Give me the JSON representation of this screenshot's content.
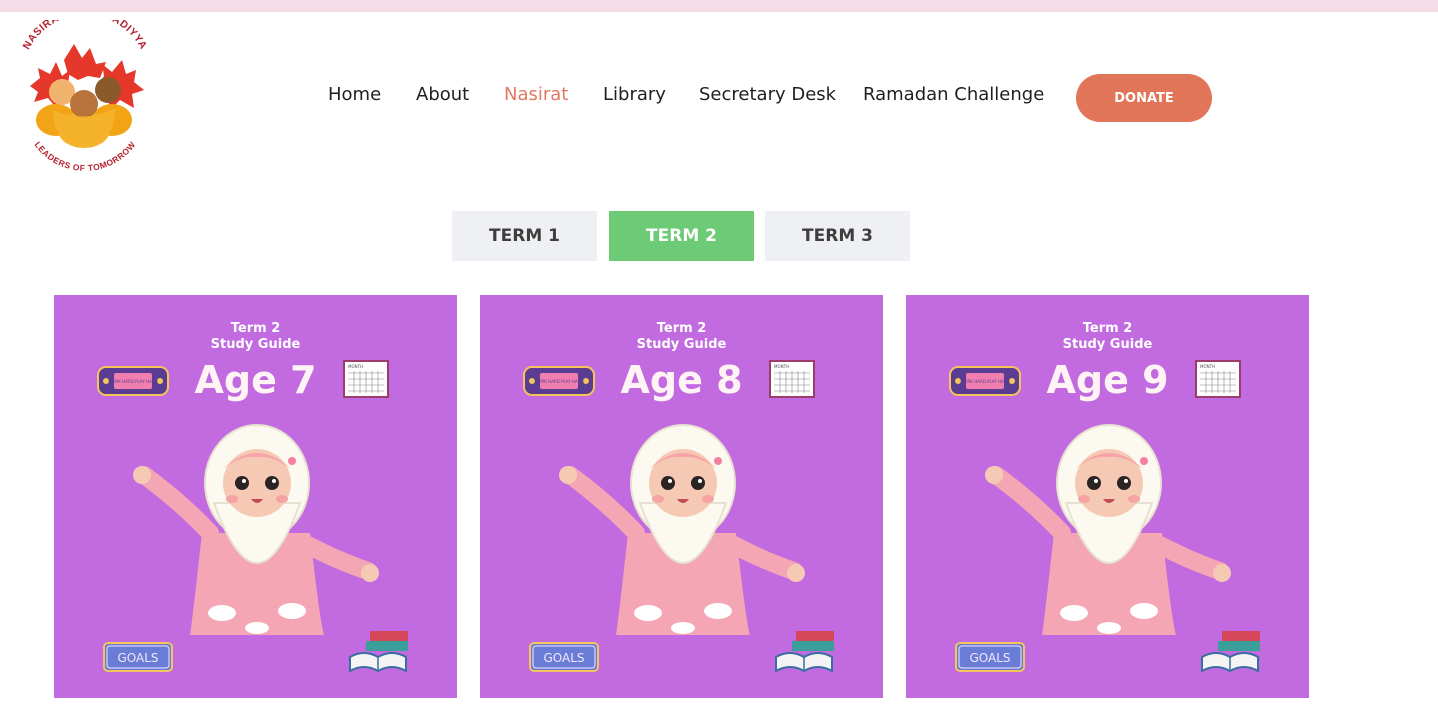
{
  "logo": {
    "top_text": "NASIRAT UL AHMADIYYA",
    "bottom_text": "LEADERS OF TOMORROW",
    "colors": {
      "text": "#b5232f",
      "leaf": "#e53a2a",
      "leaf_dark": "#f2a414"
    }
  },
  "nav": {
    "items": [
      {
        "label": "Home"
      },
      {
        "label": "About"
      },
      {
        "label": "Nasirat",
        "active": true
      },
      {
        "label": "Library"
      },
      {
        "label": "Secretary Desk"
      },
      {
        "label": "Ramadan Challenge"
      }
    ],
    "donate_label": "DONATE"
  },
  "tabs": [
    {
      "label": "TERM 1"
    },
    {
      "label": "TERM 2",
      "active": true
    },
    {
      "label": "TERM 3"
    }
  ],
  "cards": [
    {
      "line1": "Term 2",
      "line2": "Study Guide",
      "age": "Age 7",
      "game_text": "WORK HARD PLAY HARD",
      "goals_text": "GOALS",
      "calendar_text": "MONTH"
    },
    {
      "line1": "Term 2",
      "line2": "Study Guide",
      "age": "Age 8",
      "game_text": "WORK HARD PLAY HARD",
      "goals_text": "GOALS",
      "calendar_text": "MONTH"
    },
    {
      "line1": "Term 2",
      "line2": "Study Guide",
      "age": "Age 9",
      "game_text": "WORK HARD PLAY HARD",
      "goals_text": "GOALS",
      "calendar_text": "MONTH"
    }
  ],
  "colors": {
    "topbar": "#f5dce6",
    "nav_active": "#e07a63",
    "donate": "#e1755a",
    "tab_active": "#6ccb74",
    "tab_inactive": "#eef0f3",
    "card_bg": "#c26ae0"
  },
  "icons": [
    "game-console-sticker-icon",
    "calendar-sticker-icon",
    "goals-sticker-icon",
    "books-sticker-icon"
  ]
}
